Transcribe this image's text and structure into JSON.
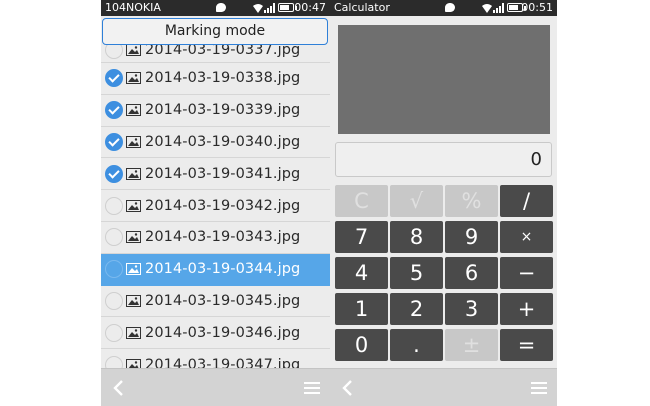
{
  "left": {
    "statusbar": {
      "title": "104NOKIA",
      "time": "00:47"
    },
    "marking_mode": "Marking mode",
    "files": [
      {
        "name": "2014-03-19-0337.jpg",
        "checked": false
      },
      {
        "name": "2014-03-19-0338.jpg",
        "checked": true
      },
      {
        "name": "2014-03-19-0339.jpg",
        "checked": true
      },
      {
        "name": "2014-03-19-0340.jpg",
        "checked": true
      },
      {
        "name": "2014-03-19-0341.jpg",
        "checked": true
      },
      {
        "name": "2014-03-19-0342.jpg",
        "checked": false
      },
      {
        "name": "2014-03-19-0343.jpg",
        "checked": false
      },
      {
        "name": "2014-03-19-0344.jpg",
        "checked": false,
        "active": true
      },
      {
        "name": "2014-03-19-0345.jpg",
        "checked": false
      },
      {
        "name": "2014-03-19-0346.jpg",
        "checked": false
      },
      {
        "name": "2014-03-19-0347.jpg",
        "checked": false
      }
    ],
    "navbar": {
      "back_icon": "back-arrow-icon",
      "menu_icon": "menu-icon"
    }
  },
  "right": {
    "statusbar": {
      "title": "Calculator",
      "time": "00:51"
    },
    "display_value": "0",
    "keys": [
      [
        "C",
        "√",
        "%",
        "/"
      ],
      [
        "7",
        "8",
        "9",
        "×"
      ],
      [
        "4",
        "5",
        "6",
        "−"
      ],
      [
        "1",
        "2",
        "3",
        "+"
      ],
      [
        "0",
        ".",
        "±",
        "="
      ]
    ],
    "disabled_keys": [
      "C",
      "√",
      "%",
      "±"
    ],
    "navbar": {
      "back_icon": "back-arrow-icon",
      "menu_icon": "menu-icon"
    }
  },
  "colors": {
    "statusbar": "#2b2b2b",
    "accent": "#3d8fe0",
    "active_row": "#56a6e8",
    "key": "#4a4a4a",
    "key_disabled": "#c8c8c8",
    "graph": "#6f6f6f"
  }
}
